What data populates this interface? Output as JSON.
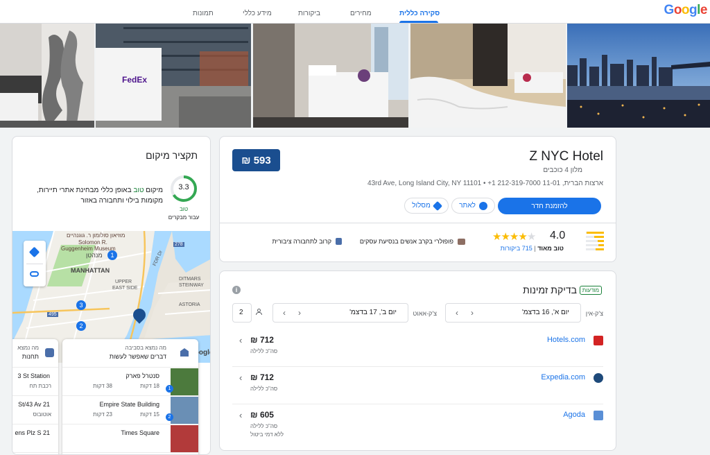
{
  "header": {
    "logo": [
      "G",
      "o",
      "o",
      "g",
      "l",
      "e"
    ],
    "logo_colors": [
      "#4285f4",
      "#ea4335",
      "#fbbc05",
      "#4285f4",
      "#34a853",
      "#ea4335"
    ],
    "tabs": [
      "סקירה כללית",
      "מחירים",
      "ביקורות",
      "מידע כללי",
      "תמונות"
    ],
    "active_tab": 0
  },
  "hotel": {
    "name": "Z NYC Hotel",
    "class": "מלון 4 כוכבים",
    "address": "ארצות הברית, 11-01 43rd Ave, Long Island City, NY 11101 • +1 212-319-7000",
    "price_badge": "593 ₪",
    "book_button": "להזמנת חדר",
    "website_button": "לאתר",
    "directions_button": "מסלול",
    "rating": "4.0",
    "rating_label": "טוב מאוד",
    "reviews": "715 ביקורות",
    "stars_filled": 4,
    "rating_bars": [
      0.95,
      0.55,
      0.35,
      0.3,
      0.45
    ],
    "highlights": [
      {
        "icon": "briefcase-icon",
        "label": "פופולרי בקרב אנשים בנסיעת עסקים"
      },
      {
        "icon": "bus-icon",
        "label": "קרוב לתחבורה ציבורית"
      }
    ]
  },
  "availability": {
    "badge": "מודעות",
    "title": "בדיקת זמינות",
    "checkin_label": "צ'ק-אין",
    "checkin_value": "יום א', 16 בדצמ'",
    "checkout_label": "צ'ק-אאוט",
    "checkout_value": "יום ב', 17 בדצמ'",
    "guests": "2",
    "offers": [
      {
        "provider": "Hotels.com",
        "price": "712 ₪",
        "note": "סה\"כ ללילה",
        "note2": "",
        "color": "#d32323"
      },
      {
        "provider": "Expedia.com",
        "price": "712 ₪",
        "note": "סה\"כ ללילה",
        "note2": "",
        "color": "#1e4a7a"
      },
      {
        "provider": "Agoda",
        "price": "605 ₪",
        "note": "סה\"כ ללילה",
        "note2": "ללא דמי ביטול",
        "color": "#5a8fd6"
      }
    ]
  },
  "location": {
    "title": "תקציר מיקום",
    "score": "3.3",
    "score_fraction": 0.66,
    "score_label": "טוב",
    "score_sub": "עבור מבקרים",
    "summary_lead": "מיקום ",
    "summary_word": "טוב",
    "summary_rest": " באופן כללי מבחינת אתרי תיירות, מקומות בילוי ותחבורה באזור",
    "map_labels": {
      "museum1": "מוזיאון סולומון ר. גוגנהיים",
      "museum2": "Solomon R.",
      "museum3": "Guggenheim Museum",
      "manhattan_he": "מנהטן",
      "manhattan": "MANHATTAN",
      "upper": "UPPER",
      "east_side": "EAST SIDE",
      "ditmars": "DITMARS",
      "steinway": "STEINWAY",
      "astoria": "ASTORIA",
      "road_278": "278",
      "road_495": "495",
      "fdr": "FDR Dr",
      "google": "Google",
      "pin1": "1",
      "pin2": "2",
      "pin3": "3"
    }
  },
  "nearby": {
    "things_header": "מה נמצא בסביבה",
    "things_title": "דברים שאפשר לעשות",
    "transit_header": "מה נמצא",
    "transit_title": "תחנות",
    "places": [
      {
        "name": "סנטרל פארק",
        "transit": "18 דקות",
        "car": "38 דקות",
        "num": "1"
      },
      {
        "name": "Empire State Building",
        "transit": "15 דקות",
        "car": "23 דקות",
        "num": "2"
      },
      {
        "name": "Times Square",
        "transit": "",
        "car": "",
        "num": "3"
      }
    ],
    "stations": [
      {
        "name": "3 St Station",
        "type": "רכבת תח"
      },
      {
        "name": "St/43 Av 21",
        "type": "אוטובוס"
      },
      {
        "name": "ens Plz S 21",
        "type": ""
      }
    ]
  }
}
